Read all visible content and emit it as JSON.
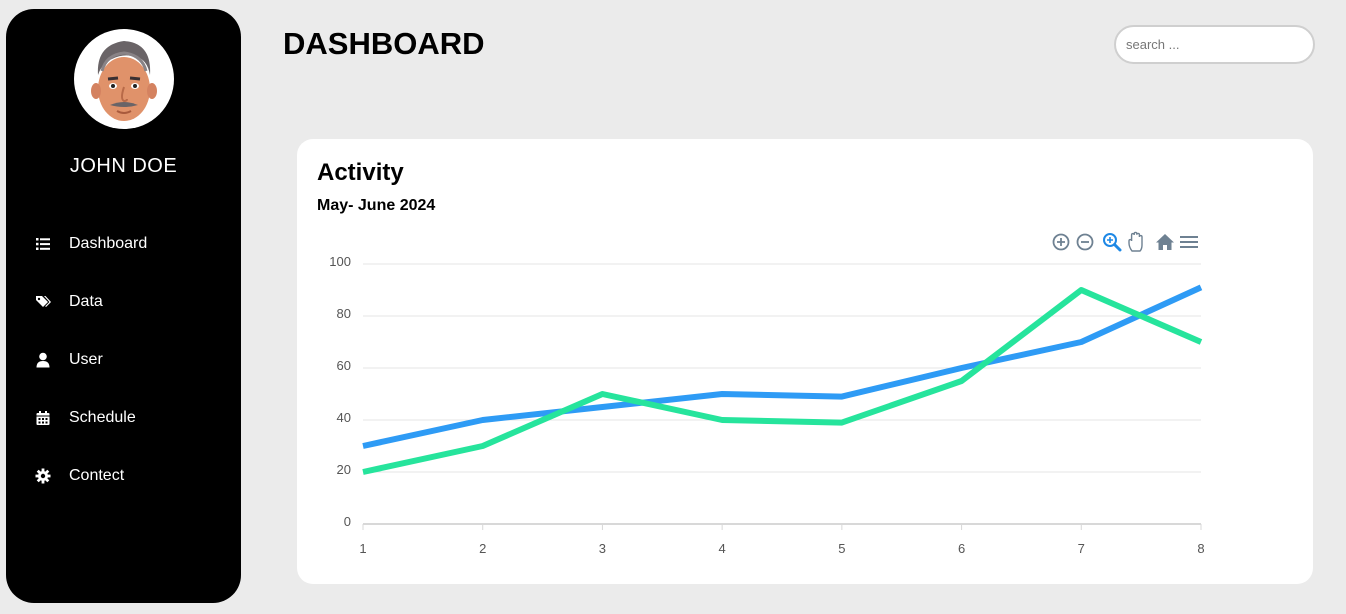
{
  "sidebar": {
    "user_name": "JOHN DOE",
    "items": [
      {
        "label": "Dashboard",
        "icon": "list-icon"
      },
      {
        "label": "Data",
        "icon": "tags-icon"
      },
      {
        "label": "User",
        "icon": "user-icon"
      },
      {
        "label": "Schedule",
        "icon": "calendar-icon"
      },
      {
        "label": "Contect",
        "icon": "gear-icon"
      }
    ]
  },
  "header": {
    "title": "DASHBOARD",
    "search_placeholder": "search ..."
  },
  "card": {
    "title": "Activity",
    "subtitle": "May- June 2024"
  },
  "toolbar": {
    "icons": [
      "zoom-in-icon",
      "zoom-out-icon",
      "zoom-select-icon",
      "pan-hand-icon",
      "home-reset-icon",
      "menu-icon"
    ],
    "active_color": "#1e88e5",
    "icon_color": "#6e8192"
  },
  "chart_data": {
    "type": "line",
    "x": [
      1,
      2,
      3,
      4,
      5,
      6,
      7,
      8
    ],
    "series": [
      {
        "values": [
          30,
          40,
          45,
          50,
          49,
          60,
          70,
          91
        ],
        "color": "#2e9bf5"
      },
      {
        "values": [
          20,
          30,
          50,
          40,
          39,
          55,
          90,
          70
        ],
        "color": "#26e49c"
      }
    ],
    "ylim": [
      0,
      100
    ],
    "yticks": [
      0,
      20,
      40,
      60,
      80,
      100
    ],
    "grid": true,
    "title": "",
    "xlabel": "",
    "ylabel": ""
  }
}
